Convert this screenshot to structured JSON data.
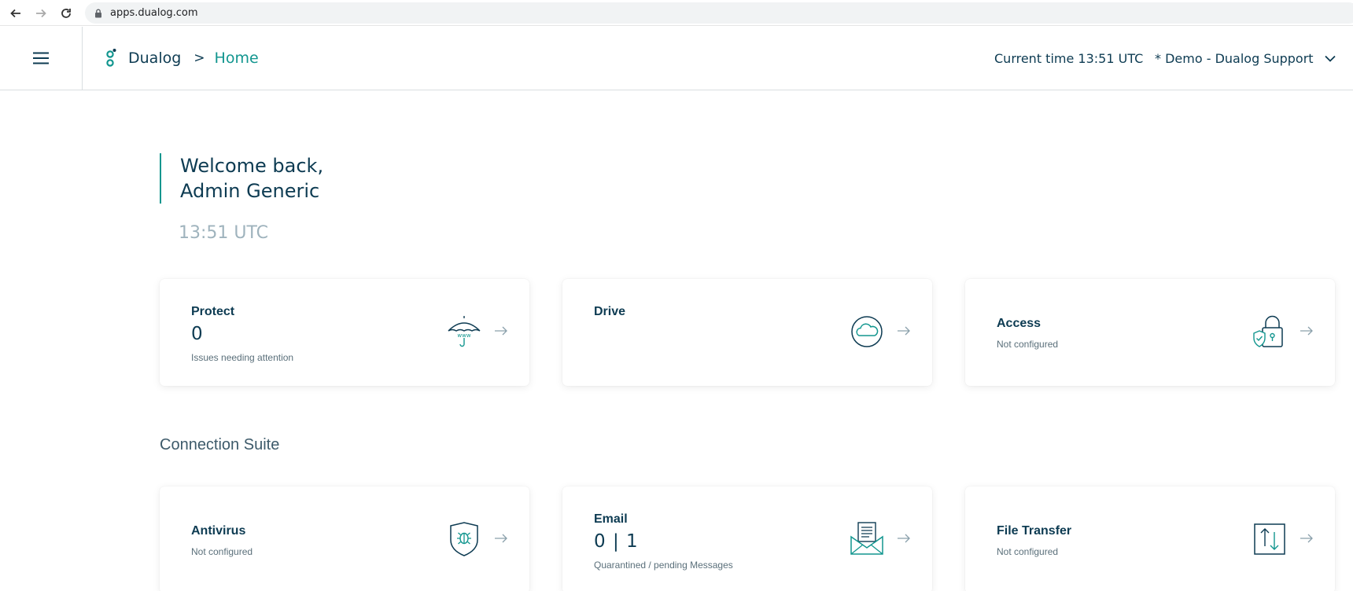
{
  "browser": {
    "url": "apps.dualog.com"
  },
  "header": {
    "brand": "Dualog",
    "breadcrumb_sep": ">",
    "breadcrumb_current": "Home",
    "current_time": "Current time 13:51 UTC",
    "tenant": "* Demo - Dualog Support"
  },
  "welcome": {
    "line1": "Welcome back,",
    "line2": "Admin Generic",
    "time": "13:51 UTC"
  },
  "top_cards": [
    {
      "title": "Protect",
      "value": "0",
      "subtitle": "Issues needing attention",
      "icon": "umbrella-www-icon"
    },
    {
      "title": "Drive",
      "value": "",
      "subtitle": "",
      "icon": "cloud-icon"
    },
    {
      "title": "Access",
      "value": "",
      "subtitle": "Not configured",
      "icon": "padlock-shield-icon"
    }
  ],
  "section": {
    "title": "Connection Suite"
  },
  "bottom_cards": [
    {
      "title": "Antivirus",
      "value": "",
      "subtitle": "Not configured",
      "icon": "shield-bug-icon"
    },
    {
      "title": "Email",
      "value": "0 | 1",
      "subtitle": "Quarantined / pending Messages",
      "icon": "envelope-icon"
    },
    {
      "title": "File Transfer",
      "value": "",
      "subtitle": "Not configured",
      "icon": "file-transfer-icon"
    }
  ],
  "colors": {
    "accent": "#12968f",
    "text": "#0d3b52",
    "muted": "#9fb3bd"
  }
}
